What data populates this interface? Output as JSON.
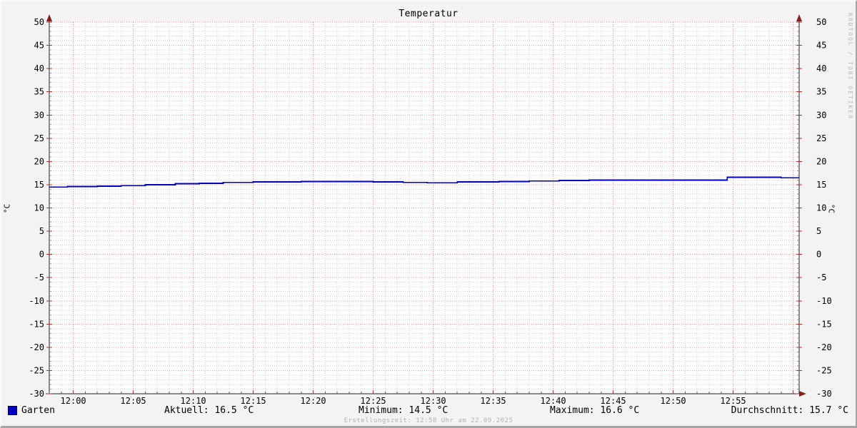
{
  "title": "Temperatur",
  "watermark": "RRDTOOL / TOBI OETIKER",
  "footer": "Erstellungszeit: 12:58 Uhr am 22.09.2025",
  "y_axis_label_left": "°C",
  "y_axis_label_right": "°C",
  "legend": {
    "series_label": "Garten",
    "swatch_color": "#0000c0"
  },
  "stats_text": {
    "aktuell": "Aktuell: 16.5 °C",
    "minimum": "Minimum: 14.5 °C",
    "maximum": "Maximum: 16.6 °C",
    "durchschnitt": "Durchschnitt: 15.7 °C"
  },
  "colors": {
    "background": "#f3f3f3",
    "plot_background": "#fdfdfd",
    "minor_grid": "#999999",
    "major_grid": "#ff0000",
    "axis": "#222222",
    "arrow": "#8a1f1f",
    "line": "#0000c0",
    "tick_label": "#000000"
  },
  "chart_data": {
    "type": "line",
    "title": "Temperatur",
    "ylabel": "°C",
    "ylim": [
      -30,
      50
    ],
    "y_tick_step": 5,
    "grid": {
      "minor_step_y": 1,
      "major_step_y": 5,
      "minor_step_x_minutes": 1,
      "major_step_x_minutes": 5,
      "grid_on": true
    },
    "x_range_minutes": [
      0,
      62.5
    ],
    "x_tick_labels": [
      "12:00",
      "12:05",
      "12:10",
      "12:15",
      "12:20",
      "12:25",
      "12:30",
      "12:35",
      "12:40",
      "12:45",
      "12:50",
      "12:55"
    ],
    "x_tick_offsets_minutes": [
      2,
      7,
      12,
      17,
      22,
      27,
      32,
      37,
      42,
      47,
      52,
      57
    ],
    "legend_position": "bottom",
    "series": [
      {
        "name": "Garten",
        "color": "#0000c0",
        "style": "step-after",
        "points_minutes_value": [
          [
            0,
            14.5
          ],
          [
            1.5,
            14.6
          ],
          [
            4,
            14.7
          ],
          [
            6,
            14.8
          ],
          [
            8,
            15.0
          ],
          [
            10.5,
            15.2
          ],
          [
            12.5,
            15.3
          ],
          [
            14.5,
            15.5
          ],
          [
            17,
            15.6
          ],
          [
            21,
            15.7
          ],
          [
            27,
            15.6
          ],
          [
            29.5,
            15.5
          ],
          [
            31.5,
            15.4
          ],
          [
            34,
            15.6
          ],
          [
            37.5,
            15.7
          ],
          [
            40,
            15.8
          ],
          [
            42.5,
            15.9
          ],
          [
            45,
            16.0
          ],
          [
            56.5,
            16.6
          ],
          [
            61,
            16.5
          ],
          [
            62.5,
            16.5
          ]
        ]
      }
    ],
    "stats": {
      "aktuell": 16.5,
      "minimum": 14.5,
      "maximum": 16.6,
      "durchschnitt": 15.7,
      "unit": "°C"
    }
  }
}
